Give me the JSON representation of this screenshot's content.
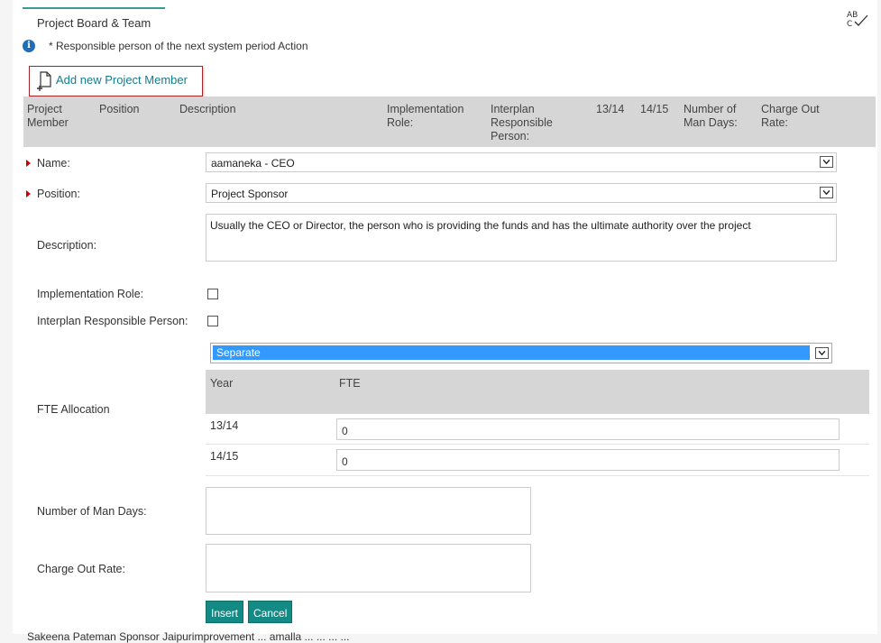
{
  "tab": {
    "title": "Project Board & Team"
  },
  "info": {
    "text": "* Responsible person of the next system period Action"
  },
  "toolbar": {
    "add_member_label": "Add new Project Member"
  },
  "grid_header": {
    "project_member": "Project Member",
    "position": "Position",
    "description": "Description",
    "implementation_role": "Implementation Role:",
    "interplan_responsible": "Interplan Responsible Person:",
    "year1": "13/14",
    "year2": "14/15",
    "man_days": "Number of Man Days:",
    "charge_out_rate": "Charge Out Rate:"
  },
  "form": {
    "name_label": "Name:",
    "name_value": "aamaneka - CEO",
    "position_label": "Position:",
    "position_value": "Project Sponsor",
    "description_label": "Description:",
    "description_value": "Usually the CEO or Director, the person who is providing the funds and has the ultimate authority over the project",
    "implementation_role_label": "Implementation Role:",
    "interplan_label": "Interplan Responsible Person:",
    "fte_label": "FTE Allocation",
    "fte_mode": "Separate",
    "fte_table": {
      "col_year": "Year",
      "col_fte": "FTE",
      "rows": [
        {
          "year": "13/14",
          "fte": "0"
        },
        {
          "year": "14/15",
          "fte": "0"
        }
      ]
    },
    "man_days_label": "Number of Man Days:",
    "charge_out_label": "Charge Out Rate:"
  },
  "buttons": {
    "insert": "Insert",
    "cancel": "Cancel"
  },
  "bottom_row": {
    "text": "Sakeena  Pateman    Sponsor  Jaipurimprovement  ...  amalla  ...  ...  ...  ..."
  },
  "colors": {
    "accent": "#148a85",
    "header_bg": "#d6d6d6",
    "highlight": "#3399ff",
    "required": "#cc0000"
  }
}
